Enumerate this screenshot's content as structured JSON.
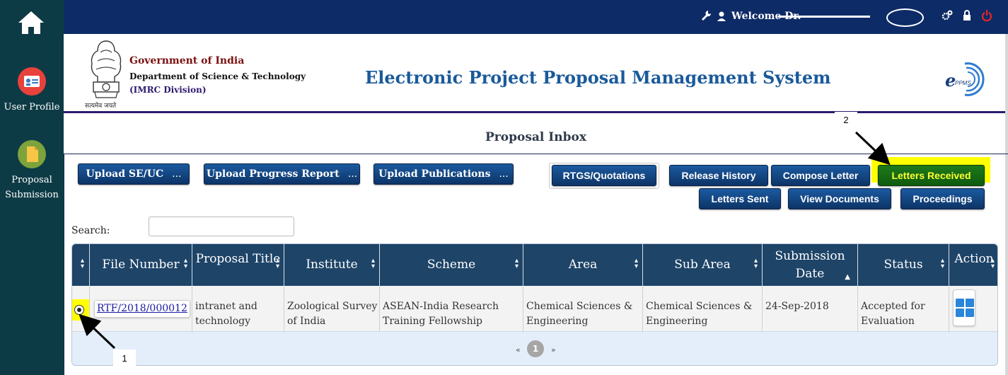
{
  "sidebar": {
    "items": [
      {
        "label": "User Profile",
        "icon": "id-card-icon"
      },
      {
        "label": "Proposal Submission",
        "icon": "document-icon"
      }
    ]
  },
  "topbar": {
    "welcome": "Welcome Dr.",
    "icons": [
      "wrench-icon",
      "user-icon",
      "gears-icon",
      "lock-icon",
      "power-icon"
    ]
  },
  "header": {
    "org_line1": "Government of India",
    "org_line2": "Department of Science & Technology",
    "org_line3": "(IMRC Division)",
    "motto": "सत्यमेव जयते",
    "system_title": "Electronic Project Proposal Management System",
    "logo_text": "PPMS"
  },
  "page": {
    "title": "Proposal Inbox"
  },
  "buttons": {
    "upload_seuc": "Upload SE/UC",
    "upload_progress": "Upload Progress Report",
    "upload_publications": "Upload Publications",
    "ellipsis": "...",
    "rtgs": "RTGS/Quotations",
    "release_history": "Release History",
    "compose_letter": "Compose Letter",
    "letters_received": "Letters Received",
    "letters_sent": "Letters Sent",
    "view_documents": "View Documents",
    "proceedings": "Proceedings"
  },
  "search": {
    "label": "Search:",
    "value": ""
  },
  "table": {
    "columns": [
      "File Number",
      "Proposal Title",
      "Institute",
      "Scheme",
      "Area",
      "Sub Area",
      "Submission Date",
      "Status",
      "Action"
    ],
    "rows": [
      {
        "file_number": "RTF/2018/000012",
        "proposal_title": "intranet and technology",
        "institute": "Zoological Survey of India",
        "scheme": "ASEAN-India Research Training Fellowship",
        "area": "Chemical Sciences & Engineering",
        "sub_area": "Chemical Sciences & Engineering",
        "submission_date": "24-Sep-2018",
        "status": "Accepted for Evaluation"
      }
    ]
  },
  "pagination": {
    "prev": "«",
    "current": "1",
    "next": "»"
  },
  "annotations": {
    "marker1": "1",
    "marker2": "2"
  },
  "colors": {
    "sidebar": "#0d3b45",
    "topbar": "#0d2b66",
    "button": "#0d3467",
    "highlight": "#ffff00",
    "letters_received_bg": "#1e7a1a"
  }
}
